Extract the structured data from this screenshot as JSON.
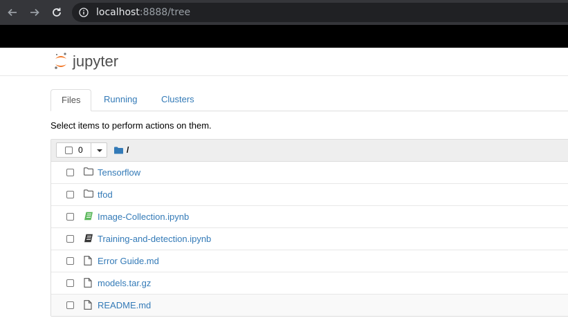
{
  "browser": {
    "url_host": "localhost",
    "url_path": ":8888/tree"
  },
  "header": {
    "logo_text": "jupyter"
  },
  "tabs": [
    {
      "label": "Files"
    },
    {
      "label": "Running"
    },
    {
      "label": "Clusters"
    }
  ],
  "hint": "Select items to perform actions on them.",
  "toolbar": {
    "selected_count": "0",
    "breadcrumb": "/"
  },
  "files": [
    {
      "name": "Tensorflow",
      "type": "folder"
    },
    {
      "name": "tfod",
      "type": "folder"
    },
    {
      "name": "Image-Collection.ipynb",
      "type": "notebook-running"
    },
    {
      "name": "Training-and-detection.ipynb",
      "type": "notebook"
    },
    {
      "name": "Error Guide.md",
      "type": "file"
    },
    {
      "name": "models.tar.gz",
      "type": "file"
    },
    {
      "name": "README.md",
      "type": "file"
    }
  ],
  "colors": {
    "link": "#337ab7",
    "jupyter_orange": "#f37726",
    "notebook_running": "#5cb85c"
  }
}
